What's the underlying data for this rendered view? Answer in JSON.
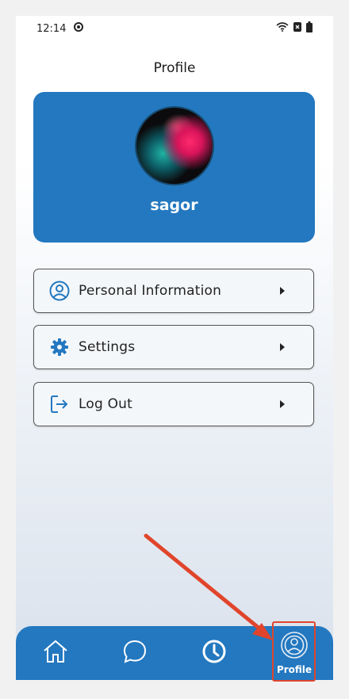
{
  "status": {
    "time": "12:14"
  },
  "header": {
    "title": "Profile"
  },
  "profile": {
    "username": "sagor"
  },
  "menu": {
    "items": [
      {
        "label": "Personal Information",
        "icon": "user-circle-icon"
      },
      {
        "label": "Settings",
        "icon": "gear-icon"
      },
      {
        "label": "Log Out",
        "icon": "logout-icon"
      }
    ]
  },
  "nav": {
    "items": [
      {
        "icon": "home-icon"
      },
      {
        "icon": "chat-icon"
      },
      {
        "icon": "clock-icon"
      },
      {
        "icon": "profile-icon",
        "label": "Profile",
        "active": true
      }
    ]
  },
  "colors": {
    "primary": "#2378c0",
    "annotation": "#e0452c"
  }
}
